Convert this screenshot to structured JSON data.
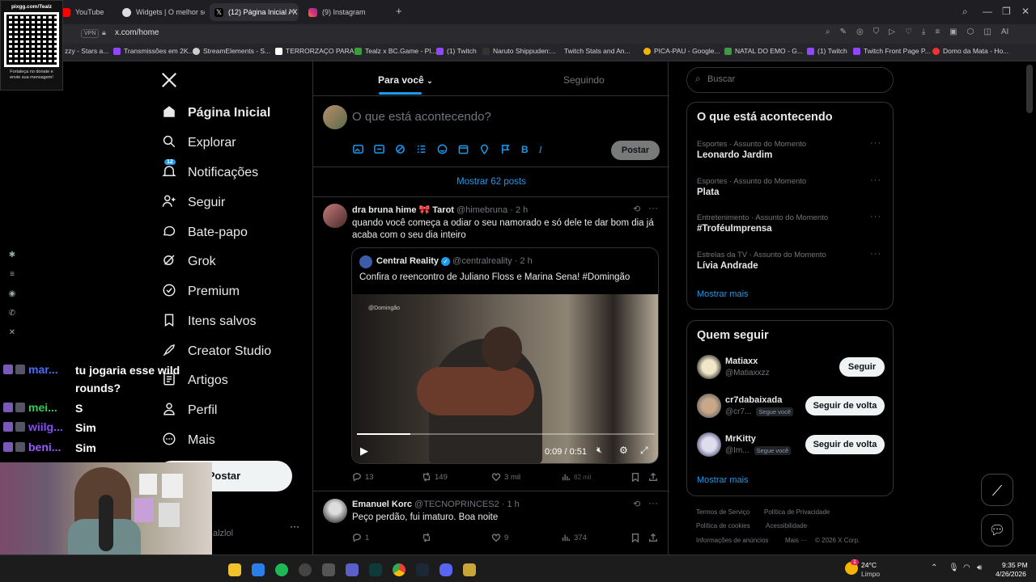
{
  "browser": {
    "tabs": [
      {
        "label": "YouTube",
        "icon": "youtube-icon",
        "color": "#ff0000"
      },
      {
        "label": "Widgets | O melhor soft",
        "icon": "widgets-icon",
        "color": "#ffffff"
      },
      {
        "label": "(12) Página Inicial / X",
        "icon": "x-logo-icon",
        "color": "#ffffff",
        "active": true
      },
      {
        "label": "(9) Instagram",
        "icon": "instagram-icon",
        "color": "#e1306c"
      }
    ],
    "vpn_label": "VPN",
    "url": "x.com/home",
    "bookmarks": [
      "zzy - Stars a...",
      "Transmissões em 2K...",
      "StreamElements - S...",
      "TERRORZAÇO PARA...",
      "Tealz x BC.Game - Pl...",
      "(1) Twitch",
      "Naruto Shippuden:...",
      "Twitch Stats and An...",
      "PICA-PAU - Google...",
      "NATAL DO EMO - G...",
      "(1) Twitch",
      "Twitch Front Page P...",
      "Domo da Mata - Ho..."
    ]
  },
  "overlay_qr": {
    "top_text": "pixgg.com/Tealz",
    "bottom_text": "Fortaleça no donate e envie sua mensagem!"
  },
  "nav": {
    "items": [
      {
        "label": "Página Inicial",
        "icon": "home-icon"
      },
      {
        "label": "Explorar",
        "icon": "search-icon"
      },
      {
        "label": "Notificações",
        "icon": "bell-icon",
        "badge": "12"
      },
      {
        "label": "Seguir",
        "icon": "add-user-icon"
      },
      {
        "label": "Bate-papo",
        "icon": "chat-icon"
      },
      {
        "label": "Grok",
        "icon": "grok-icon"
      },
      {
        "label": "Premium",
        "icon": "verified-icon"
      },
      {
        "label": "Itens salvos",
        "icon": "bookmark-icon"
      },
      {
        "label": "Creator Studio",
        "icon": "rocket-icon"
      },
      {
        "label": "Artigos",
        "icon": "article-icon"
      },
      {
        "label": "Perfil",
        "icon": "person-icon"
      },
      {
        "label": "Mais",
        "icon": "more-circle-icon"
      }
    ],
    "post_button": "Postar",
    "account_handle": "alzlol"
  },
  "feed": {
    "tab_for_you": "Para você",
    "tab_following": "Seguindo",
    "composer_placeholder": "O que está acontecendo?",
    "composer_post_button": "Postar",
    "show_posts": "Mostrar 62 posts",
    "post1": {
      "name": "dra bruna hime 🎀 Tarot",
      "handle": "@himebruna",
      "time": "· 2 h",
      "text": "quando você começa a odiar o seu namorado e só dele te dar bom dia já acaba com o seu dia inteiro",
      "quote": {
        "name": "Central Reality",
        "handle": "@centralreality",
        "time": "· 2 h",
        "text": "Confira o reencontro de Juliano Floss e Marina Sena! #Domingão",
        "video_time": "0:09 / 0:51",
        "progress": 0.18,
        "watermark": "@Domingão"
      },
      "replies": "13",
      "reposts": "149",
      "likes": "3 mil",
      "views": "82 mil"
    },
    "post2": {
      "name": "Emanuel Korc",
      "handle": "@TECNOPRINCES2",
      "time": "· 1 h",
      "text": "Peço perdão, fui imaturo. Boa noite",
      "replies": "1",
      "likes": "9",
      "views": "374"
    }
  },
  "right": {
    "search_placeholder": "Buscar",
    "trends_title": "O que está acontecendo",
    "trends": [
      {
        "category": "Esportes · Assunto do Momento",
        "name": "Leonardo Jardim"
      },
      {
        "category": "Esportes · Assunto do Momento",
        "name": "Plata"
      },
      {
        "category": "Entretenimento · Assunto do Momento",
        "name": "#TroféuImprensa"
      },
      {
        "category": "Estrelas da TV · Assunto do Momento",
        "name": "Lívia Andrade"
      }
    ],
    "show_more": "Mostrar mais",
    "follow_title": "Quem seguir",
    "follow": [
      {
        "name": "Matiaxx",
        "handle": "@Matiaxxzz",
        "button": "Seguir",
        "follows_you": ""
      },
      {
        "name": "cr7dabaixada",
        "handle": "@cr7...",
        "button": "Seguir de volta",
        "follows_you": "Segue você"
      },
      {
        "name": "MrKitty",
        "handle": "@Im...",
        "button": "Seguir de volta",
        "follows_you": "Segue você"
      }
    ],
    "show_more2": "Mostrar mais",
    "footer": [
      "Termos de Serviço",
      "Política de Privacidade",
      "Política de cookies",
      "Acessibilidade",
      "Informações de anúncios",
      "Mais ···",
      "© 2026 X Corp."
    ]
  },
  "chat": {
    "lines": [
      {
        "user": "mar...",
        "color": "#4a6cff",
        "msg": "tu jogaria esse wild rounds?"
      },
      {
        "user": "mei...",
        "color": "#33cc55",
        "msg": "S"
      },
      {
        "user": "wiilg...",
        "color": "#8a4bff",
        "msg": "Sim"
      },
      {
        "user": "beni...",
        "color": "#9b59ff",
        "msg": "Sim"
      }
    ]
  },
  "taskbar": {
    "weather_temp": "24°C",
    "weather_desc": "Limpo",
    "time": "9:35 PM",
    "date": "4/26/2026",
    "weather_badge": "1"
  }
}
